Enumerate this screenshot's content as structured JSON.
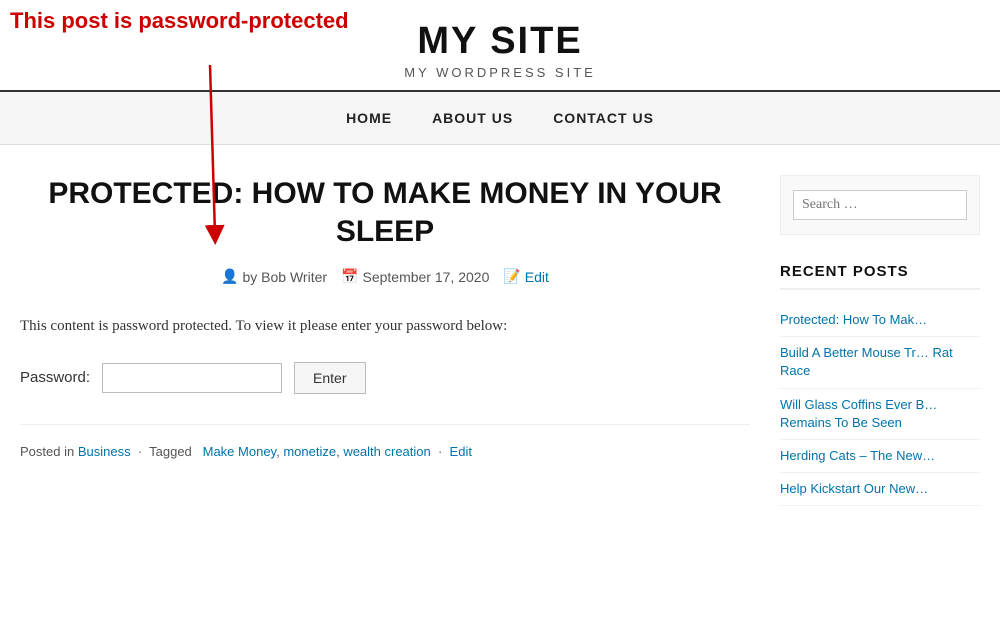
{
  "annotation": {
    "text": "This post is password-protected"
  },
  "header": {
    "site_title": "MY SITE",
    "site_subtitle": "MY WORDPRESS SITE"
  },
  "nav": {
    "items": [
      {
        "label": "HOME",
        "id": "home"
      },
      {
        "label": "ABOUT US",
        "id": "about"
      },
      {
        "label": "CONTACT US",
        "id": "contact"
      }
    ]
  },
  "post": {
    "title": "PROTECTED: HOW TO MAKE MONEY IN YOUR SLEEP",
    "meta": {
      "author": "by Bob Writer",
      "date": "September 17, 2020",
      "edit_label": "Edit"
    },
    "password_notice": "This content is password protected. To view it please enter your password below:",
    "password_label": "Password:",
    "password_placeholder": "",
    "enter_button": "Enter",
    "footer": {
      "posted_in_label": "Posted in",
      "category": "Business",
      "tagged_label": "Tagged",
      "tags": [
        "Make Money",
        "monetize",
        "wealth creation"
      ],
      "edit_label": "Edit"
    }
  },
  "sidebar": {
    "search_placeholder": "Search …",
    "recent_posts_title": "RECENT POSTS",
    "recent_posts": [
      {
        "label": "Protected: How To Mak…"
      },
      {
        "label": "Build A Better Mouse Tr… Rat Race"
      },
      {
        "label": "Will Glass Coffins Ever B… Remains To Be Seen"
      },
      {
        "label": "Herding Cats – The New…"
      },
      {
        "label": "Help Kickstart Our New…"
      }
    ]
  }
}
